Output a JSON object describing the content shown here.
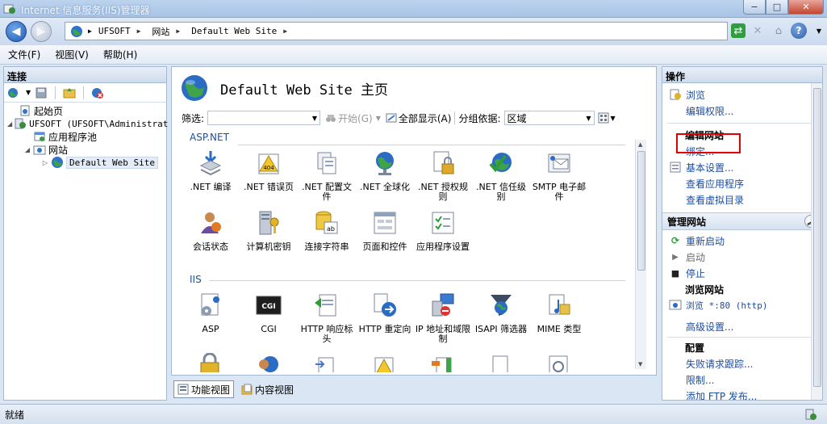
{
  "window": {
    "title": "Internet 信息服务(IIS)管理器",
    "controls": {
      "minimize": "−",
      "maximize": "□",
      "close": "✕"
    }
  },
  "address": {
    "crumbs": [
      "UFSOFT",
      "网站",
      "Default Web Site"
    ]
  },
  "menu": [
    "文件(F)",
    "视图(V)",
    "帮助(H)"
  ],
  "connections": {
    "title": "连接",
    "tree": [
      {
        "label": "起始页",
        "level": 1
      },
      {
        "label": "UFSOFT (UFSOFT\\Administrat",
        "level": 0
      },
      {
        "label": "应用程序池",
        "level": 2
      },
      {
        "label": "网站",
        "level": 2
      },
      {
        "label": "Default Web Site",
        "level": 3
      }
    ]
  },
  "center": {
    "title": "Default Web Site 主页",
    "filter": {
      "label": "筛选:",
      "start": "开始(G)",
      "showall": "全部显示(A)",
      "groupby_label": "分组依据:",
      "groupby_value": "区域"
    },
    "sections": [
      {
        "name": "ASP.NET",
        "features": [
          {
            "label": ".NET 编译",
            "icon": "download-stack-icon"
          },
          {
            "label": ".NET 错误页",
            "icon": "warning-404-icon"
          },
          {
            "label": ".NET 配置文件",
            "icon": "config-file-icon"
          },
          {
            "label": ".NET 全球化",
            "icon": "globe-icon"
          },
          {
            "label": ".NET 授权规则",
            "icon": "lock-doc-icon"
          },
          {
            "label": ".NET 信任级别",
            "icon": "check-globe-icon"
          },
          {
            "label": "SMTP 电子邮件",
            "icon": "mail-icon"
          },
          {
            "label": "会话状态",
            "icon": "user-session-icon"
          },
          {
            "label": "计算机密钥",
            "icon": "server-key-icon"
          },
          {
            "label": "连接字符串",
            "icon": "db-string-icon"
          },
          {
            "label": "页面和控件",
            "icon": "page-controls-icon"
          },
          {
            "label": "应用程序设置",
            "icon": "app-settings-icon"
          }
        ]
      },
      {
        "name": "IIS",
        "features": [
          {
            "label": "ASP",
            "icon": "asp-icon"
          },
          {
            "label": "CGI",
            "icon": "cgi-icon"
          },
          {
            "label": "HTTP 响应标头",
            "icon": "http-header-icon"
          },
          {
            "label": "HTTP 重定向",
            "icon": "redirect-icon"
          },
          {
            "label": "IP 地址和域限制",
            "icon": "ip-restrict-icon"
          },
          {
            "label": "ISAPI 筛选器",
            "icon": "isapi-filter-icon"
          },
          {
            "label": "MIME 类型",
            "icon": "mime-icon"
          }
        ]
      }
    ],
    "view_tabs": [
      "功能视图",
      "内容视图"
    ]
  },
  "actions": {
    "title": "操作",
    "items_top": [
      "浏览",
      "编辑权限..."
    ],
    "edit_site_title": "编辑网站",
    "edit_site_items": [
      "绑定...",
      "基本设置...",
      "查看应用程序",
      "查看虚拟目录"
    ],
    "manage_title": "管理网站",
    "manage_items": [
      "重新启动",
      "启动",
      "停止"
    ],
    "browse_title": "浏览网站",
    "browse_item": "浏览 *:80 (http)",
    "advanced": "高级设置...",
    "config_title": "配置",
    "config_items": [
      "失败请求跟踪...",
      "限制...",
      "添加 FTP 发布..."
    ]
  },
  "status": {
    "text": "就绪"
  },
  "colors": {
    "link": "#1c4da0",
    "highlight": "#e00000",
    "section": "#1b4f9c"
  }
}
